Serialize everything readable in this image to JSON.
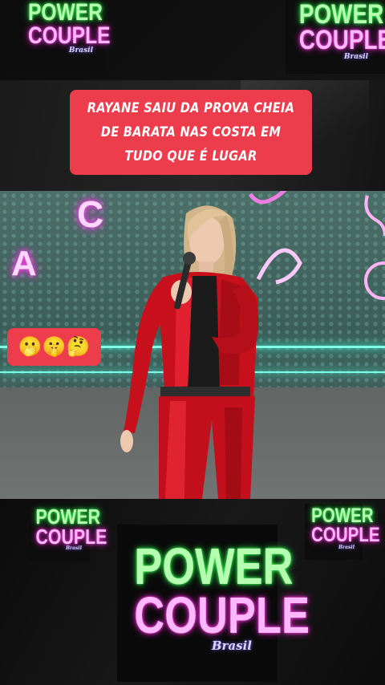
{
  "logos": {
    "word1": "POWER",
    "word2": "COUPLE",
    "word3": "Brasil"
  },
  "caption": {
    "text": "RAYANE SAIU DA PROVA CHEIA DE BARATA NAS COSTA EM TUDO QUE É LUGAR"
  },
  "emojis": {
    "text": "🫢🤫🤔"
  },
  "neon_letters": {
    "c": "C",
    "a": "A"
  },
  "colors": {
    "caption_bg": "#ed3d4d",
    "logo_green": "#3cff57",
    "logo_pink": "#ff39e5",
    "jacket_red": "#c8101c"
  }
}
